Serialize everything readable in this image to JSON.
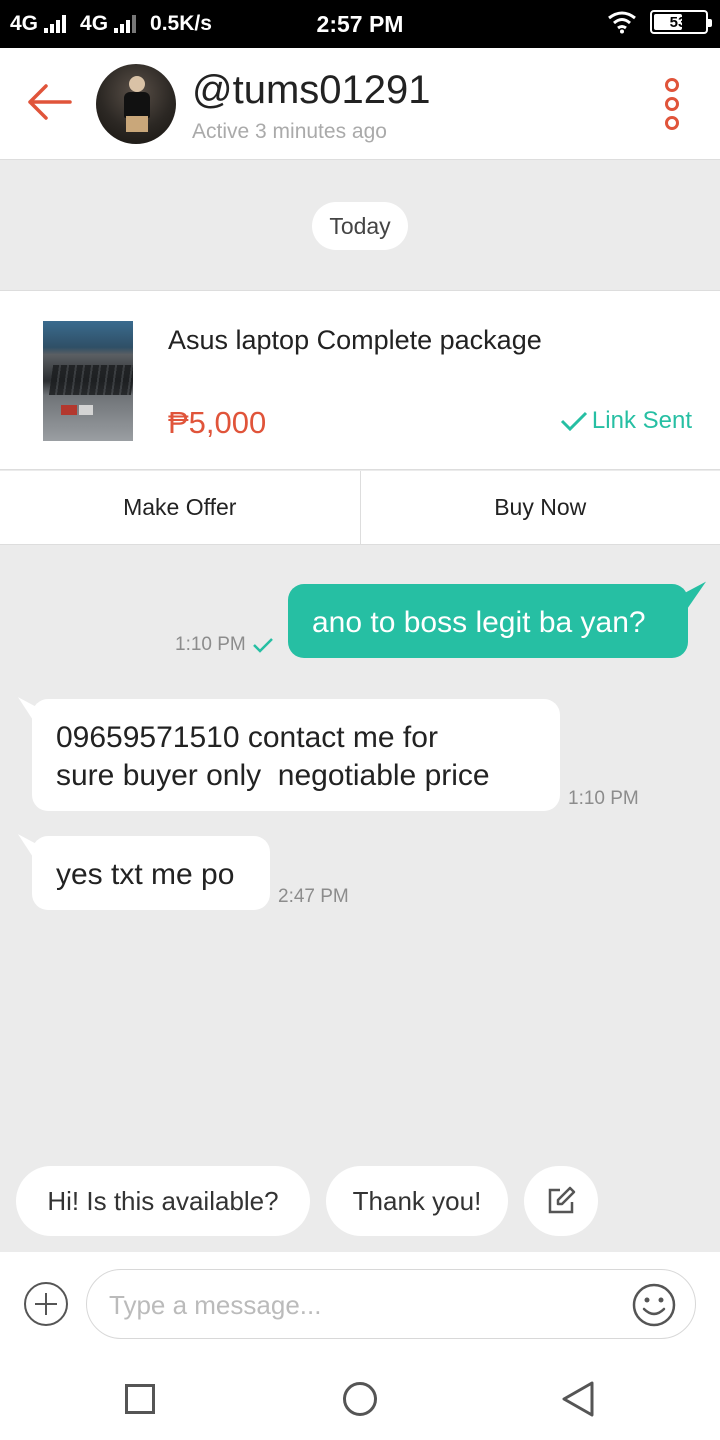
{
  "status_bar": {
    "left_text": "4G",
    "left_text_2": "4G",
    "net_speed": "0.5K/s",
    "time": "2:57 PM",
    "battery": "53"
  },
  "header": {
    "username": "@tums01291",
    "status": "Active 3 minutes ago"
  },
  "date_chip": "Today",
  "product": {
    "title": "Asus laptop Complete package",
    "price": "₱5,000",
    "link_status": "Link Sent"
  },
  "actions": {
    "make_offer": "Make Offer",
    "buy_now": "Buy Now"
  },
  "messages": [
    {
      "direction": "outgoing",
      "text": "ano to boss legit ba yan?",
      "time": "1:10 PM"
    },
    {
      "direction": "incoming",
      "text": "09659571510 contact me for\nsure buyer only  negotiable price",
      "time": "1:10 PM"
    },
    {
      "direction": "incoming",
      "text": "yes txt me po",
      "time": "2:47 PM"
    }
  ],
  "quick_replies": [
    "Hi! Is this available?",
    "Thank you!"
  ],
  "composer": {
    "placeholder": "Type a message..."
  },
  "colors": {
    "accent_teal": "#26bfa3",
    "accent_red": "#e0543a",
    "chat_background": "#ebebeb"
  },
  "icons": [
    "back-arrow-icon",
    "more-vertical-icon",
    "check-icon",
    "edit-icon",
    "add-icon",
    "emoji-icon",
    "recents-icon",
    "home-icon",
    "back-nav-icon",
    "wifi-icon",
    "signal-icon",
    "battery-icon"
  ]
}
